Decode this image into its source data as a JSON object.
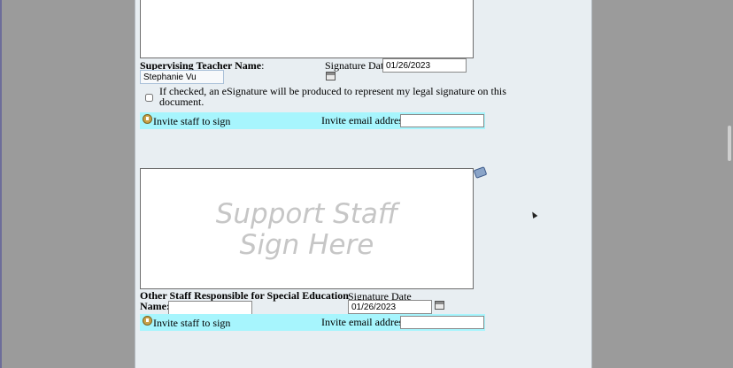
{
  "teacher_section": {
    "name_label": "Supervising Teacher Name",
    "name_colon": ":",
    "name_value": "Stephanie Vu",
    "date_label": "Signature Date",
    "date_value": "01/26/2023",
    "esig_text_line1": "If checked, an eSignature will be produced to represent my legal signature on this",
    "esig_text_line2": "document."
  },
  "invite": {
    "sign_label": "Invite staff to sign",
    "email_label": "Invite email address:",
    "email_value": ""
  },
  "support_section": {
    "placeholder_line1": "Support Staff",
    "placeholder_line2": "Sign Here",
    "name_label_line1": "Other Staff Responsible for Special Education",
    "name_label_line2": "Name:",
    "name_value": "",
    "date_label": "Signature Date",
    "date_value": "01/26/2023"
  },
  "icons": {
    "calendar": "calendar-icon",
    "invite": "invite-icon",
    "eraser": "eraser-icon"
  },
  "colors": {
    "invite_bar": "#a7f5fd",
    "page_bg": "#e8eef2",
    "placeholder": "#c6c6c6"
  }
}
